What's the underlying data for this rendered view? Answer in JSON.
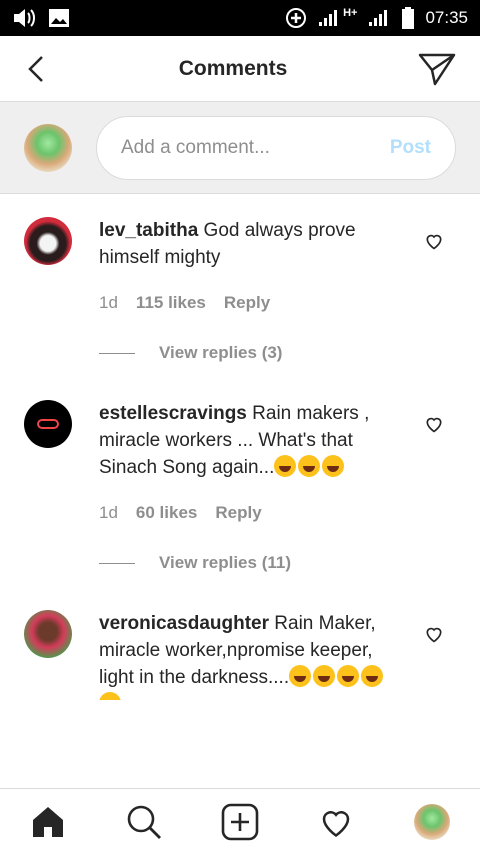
{
  "status_bar": {
    "time": "07:35",
    "network": "H+"
  },
  "header": {
    "title": "Comments"
  },
  "composer": {
    "placeholder": "Add a comment...",
    "post_label": "Post"
  },
  "comments": [
    {
      "user": "lev_tabitha",
      "text": " God always prove himself mighty",
      "age": "1d",
      "likes": "115 likes",
      "reply": "Reply",
      "view_replies": "View replies (3)"
    },
    {
      "user": "estellescravings",
      "text": " Rain makers , miracle workers ... What's that Sinach Song again...",
      "emoji": [
        "grinning-squinting-face",
        "grinning-squinting-face",
        "grinning-squinting-face"
      ],
      "age": "1d",
      "likes": "60 likes",
      "reply": "Reply",
      "view_replies": "View replies (11)"
    },
    {
      "user": "veronicasdaughter",
      "text": " Rain Maker, miracle worker,npromise keeper, light in the darkness....",
      "emoji": [
        "rolling-on-floor-laughing",
        "rolling-on-floor-laughing",
        "rolling-on-floor-laughing",
        "rolling-on-floor-laughing",
        "rolling-on-floor-laughing"
      ]
    }
  ],
  "bottom_nav": [
    "home-icon",
    "search-icon",
    "new-post-icon",
    "activity-icon",
    "profile-avatar"
  ]
}
